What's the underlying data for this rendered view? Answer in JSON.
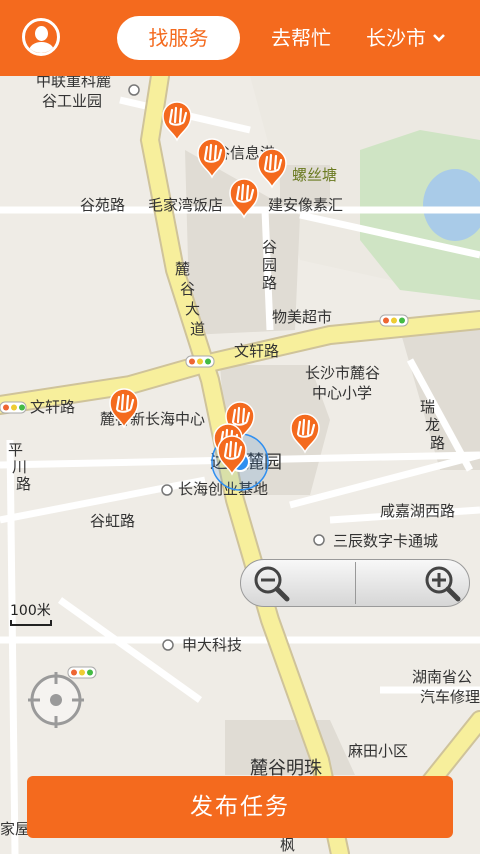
{
  "header": {
    "tab_active_label": "找服务",
    "tab_label": "去帮忙",
    "city_label": "长沙市"
  },
  "map_labels": {
    "l1": "中联重科麓",
    "l2": "谷工业园",
    "l3": "麓谷信息港",
    "l4": "螺丝塘",
    "l5": "谷苑路",
    "l6": "毛家湾饭店",
    "l7": "建安像素汇",
    "l8": "谷",
    "l9": "园",
    "l10": "路",
    "l11": "麓",
    "l12": "谷",
    "l13": "大",
    "l14": "道",
    "l15": "物美超市",
    "l16": "文轩路",
    "l17": "长沙市麓谷",
    "l18": "中心小学",
    "l19": "文轩路",
    "l20": "麓谷新长海中心",
    "l21": "瑞",
    "l22": "龙",
    "l23": "路",
    "l24": "平",
    "l25": "川",
    "l26": "路",
    "l27": "达美麓园",
    "l28": "长海创业基地",
    "l29": "谷虹路",
    "l30": "咸嘉湖西路",
    "l31": "三辰数字卡通城",
    "l32": "申大科技",
    "l33": "湖南省公",
    "l34": "汽车修理",
    "l35": "麻田小区",
    "l36": "麓谷明珠",
    "l37": "家屋",
    "l38": "枫"
  },
  "scale_label": "100米",
  "publish_label": "发布任务",
  "colors": {
    "accent": "#f46a1e",
    "road_main": "#f7ef9c",
    "location": "#2f8ff0"
  }
}
